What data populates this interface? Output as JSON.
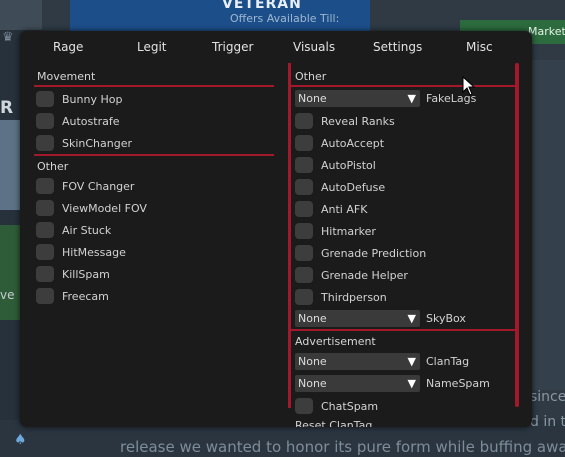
{
  "background": {
    "banner_title": "VETERAN",
    "banner_offers": "Offers Available Till:",
    "market_label": "Market",
    "left_text_1": "R",
    "left_text_2": "ve",
    "bottom_text": "release we wanted to honor its pure form while buffing away",
    "right_text_1": "since",
    "right_text_2": "d in t"
  },
  "tabs": [
    "Rage",
    "Legit",
    "Trigger",
    "Visuals",
    "Settings",
    "Misc"
  ],
  "left": {
    "movement_title": "Movement",
    "movement_items": [
      "Bunny Hop",
      "Autostrafe",
      "SkinChanger"
    ],
    "other_title": "Other",
    "other_items": [
      "FOV Changer",
      "ViewModel FOV",
      "Air Stuck",
      "HitMessage",
      "KillSpam",
      "Freecam"
    ]
  },
  "right": {
    "other_title": "Other",
    "fakelags": {
      "value": "None",
      "label": "FakeLags"
    },
    "items": [
      "Reveal Ranks",
      "AutoAccept",
      "AutoPistol",
      "AutoDefuse",
      "Anti AFK",
      "Hitmarker",
      "Grenade Prediction",
      "Grenade Helper",
      "Thirdperson"
    ],
    "skybox": {
      "value": "None",
      "label": "SkyBox"
    },
    "advert_title": "Advertisement",
    "clantag": {
      "value": "None",
      "label": "ClanTag"
    },
    "namespam": {
      "value": "None",
      "label": "NameSpam"
    },
    "chatspam_label": "ChatSpam",
    "reset_label": "Reset ClanTag"
  },
  "colors": {
    "accent": "#a3192c",
    "menu_bg": "#1b1b1b",
    "checkbox": "#3d3d3d"
  }
}
